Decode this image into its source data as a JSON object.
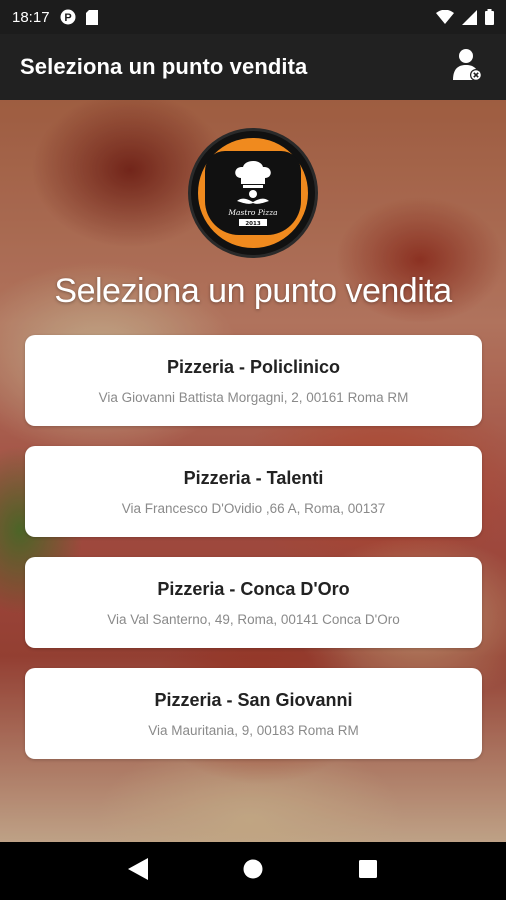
{
  "status_bar": {
    "time": "18:17",
    "icons": [
      "notification-app-icon",
      "sd-card-icon",
      "wifi-icon",
      "signal-icon",
      "battery-icon"
    ]
  },
  "app_bar": {
    "title": "Seleziona un punto vendita",
    "account_icon": "user-remove-icon"
  },
  "logo": {
    "brand": "Mastro Pizza",
    "year": "2013",
    "colors": {
      "ring": "#f08a1e",
      "body": "#111111"
    }
  },
  "heading": "Seleziona un punto vendita",
  "stores": [
    {
      "name": "Pizzeria - Policlinico",
      "address": "Via Giovanni Battista Morgagni, 2, 00161 Roma RM"
    },
    {
      "name": "Pizzeria - Talenti",
      "address": "Via Francesco D'Ovidio ,66 A, Roma, 00137"
    },
    {
      "name": "Pizzeria - Conca D'Oro",
      "address": "Via Val Santerno, 49, Roma, 00141 Conca D'Oro"
    },
    {
      "name": "Pizzeria - San Giovanni",
      "address": "Via Mauritania, 9, 00183 Roma RM"
    }
  ],
  "nav_bar": {
    "buttons": [
      "back-icon",
      "home-icon",
      "recents-icon"
    ]
  }
}
